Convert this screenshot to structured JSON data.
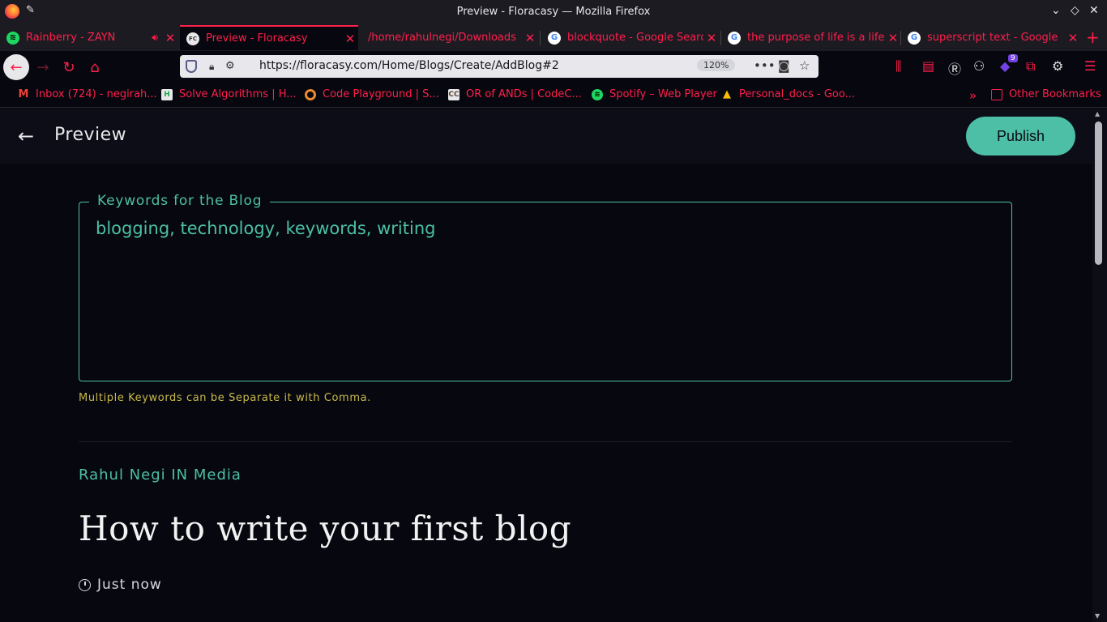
{
  "window": {
    "title": "Preview - Floracasy — Mozilla Firefox"
  },
  "tabs": [
    {
      "label": "Rainberry - ZAYN",
      "icon": "spotify-icon"
    },
    {
      "label": "Preview - Floracasy",
      "icon": "floracasy-icon"
    },
    {
      "label": "/home/rahulnegi/Downloads",
      "icon": ""
    },
    {
      "label": "blockquote - Google Search",
      "icon": "google-icon"
    },
    {
      "label": "the purpose of life is a life",
      "icon": "google-icon"
    },
    {
      "label": "superscript text - Google",
      "icon": "google-icon"
    }
  ],
  "navbar": {
    "url": "https://floracasy.com/Home/Blogs/Create/AddBlog#2",
    "zoom": "120%",
    "extension_badge": "9"
  },
  "bookmarks": [
    {
      "label": "Inbox (724) - negirah...",
      "icon": "gmail-icon"
    },
    {
      "label": "Solve Algorithms | H...",
      "icon": "hackerrank-icon"
    },
    {
      "label": "Code Playground | S...",
      "icon": "sololearn-icon"
    },
    {
      "label": "OR of ANDs | CodeC...",
      "icon": "codechef-icon"
    },
    {
      "label": "Spotify – Web Player",
      "icon": "spotify-icon"
    },
    {
      "label": "Personal_docs - Goo...",
      "icon": "google-drive-icon"
    }
  ],
  "other_bookmarks": "Other Bookmarks",
  "app": {
    "header_title": "Preview",
    "publish_label": "Publish",
    "keywords_legend": "Keywords for the Blog",
    "keywords_value": "blogging, technology, keywords, writing",
    "keywords_help": "Multiple Keywords can be Separate it with Comma.",
    "author": "Rahul Negi IN Media",
    "blog_title": "How to write your first blog",
    "timestamp": "Just now"
  },
  "colors": {
    "accent": "#4cbfa6",
    "browser_accent": "#ff1f4b",
    "help_text": "#c8b84a",
    "background": "#07080f"
  }
}
